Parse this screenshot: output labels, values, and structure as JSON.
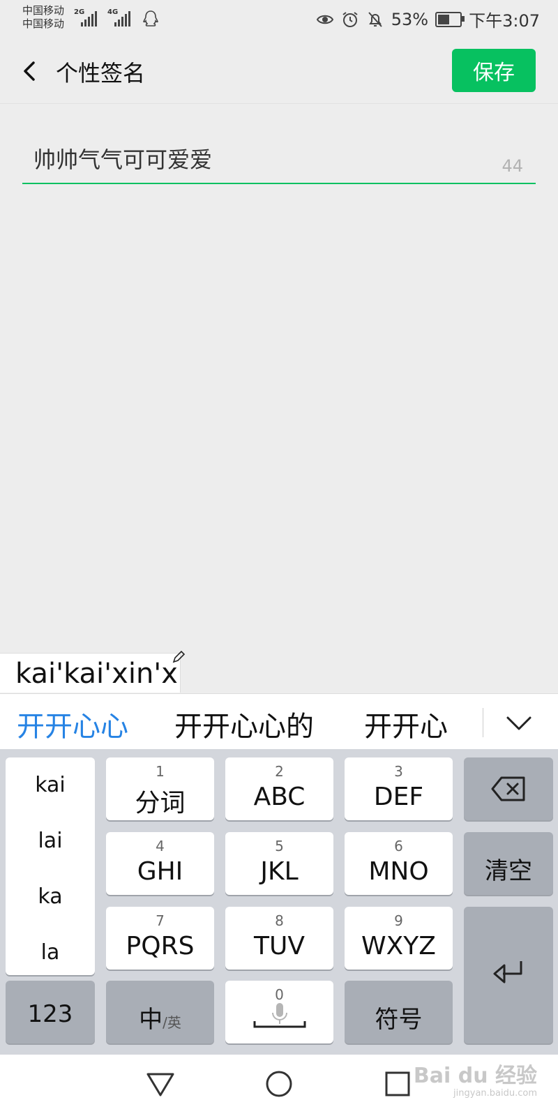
{
  "status_bar": {
    "carrier1": "中国移动",
    "carrier2": "中国移动",
    "net1": "2G",
    "net2": "4G",
    "icons": [
      "qq-icon",
      "eye-icon",
      "alarm-icon",
      "bell-off-icon",
      "battery-icon"
    ],
    "battery_percent": "53%",
    "battery_level": 0.53,
    "time": "下午3:07"
  },
  "header": {
    "title": "个性签名",
    "save_label": "保存",
    "accent_color": "#07c160"
  },
  "signature": {
    "value": "帅帅气气可可爱爱",
    "remaining": "44"
  },
  "ime": {
    "composition": "kai'kai'xin'x",
    "candidates": [
      "开开心心",
      "开开心心的",
      "开开心"
    ],
    "active_candidate_color": "#2683e4",
    "syllables": [
      "kai",
      "lai",
      "ka",
      "la"
    ],
    "keys": [
      {
        "num": "1",
        "label": "分词"
      },
      {
        "num": "2",
        "label": "ABC"
      },
      {
        "num": "3",
        "label": "DEF"
      },
      {
        "num": "4",
        "label": "GHI"
      },
      {
        "num": "5",
        "label": "JKL"
      },
      {
        "num": "6",
        "label": "MNO"
      },
      {
        "num": "7",
        "label": "PQRS"
      },
      {
        "num": "8",
        "label": "TUV"
      },
      {
        "num": "9",
        "label": "WXYZ"
      }
    ],
    "clear_label": "清空",
    "numbers_label": "123",
    "lang_main": "中",
    "lang_sub": "/英",
    "space_num": "0",
    "symbols_label": "符号"
  },
  "watermark": {
    "line1": "Bai du 经验",
    "line2": "jingyan.baidu.com"
  }
}
